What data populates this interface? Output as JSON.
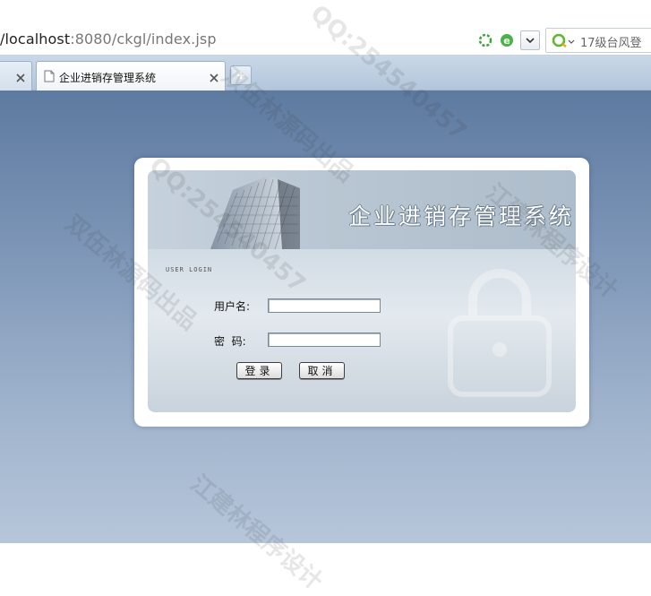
{
  "address_bar": {
    "url_host": "/localhost",
    "url_rest": ":8080/ckgl/index.jsp",
    "search_placeholder": "17级台风登",
    "icons": [
      "refresh-icon",
      "ie-compat-icon",
      "dropdown-arrow-icon",
      "search-engine-icon"
    ]
  },
  "tabs": [
    {
      "label": "",
      "active": false
    },
    {
      "label": "企业进销存管理系统",
      "active": true
    }
  ],
  "login": {
    "banner_title": "企业进销存管理系统",
    "subtitle": "USER LOGIN",
    "username_label": "用户名:",
    "username_value": "",
    "password_label": "密  码:",
    "password_value": "",
    "login_button": "登录",
    "cancel_button": "取消"
  },
  "watermarks": [
    "QQ:2545404​57",
    "双伍林源码出品",
    "江建林程序设计",
    "QQ:254540457",
    "双伍林源码出品",
    "江建林程序设计"
  ],
  "colors": {
    "page_top": "#5d7aa0",
    "page_bottom": "#b6c6da",
    "panel_bg": "#ffffff"
  }
}
